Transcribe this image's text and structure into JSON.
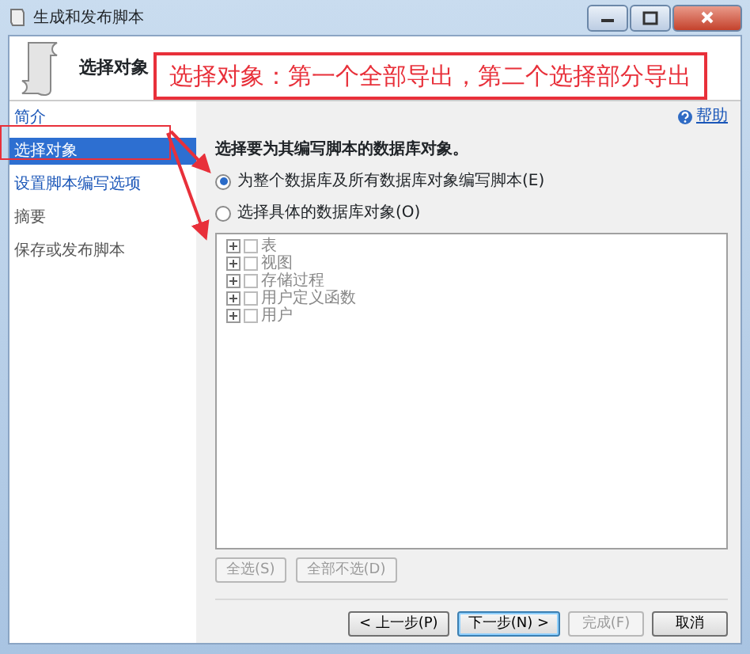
{
  "window": {
    "title": "生成和发布脚本"
  },
  "header": {
    "title": "选择对象"
  },
  "annotation": {
    "text": "选择对象：第一个全部导出，第二个选择部分导出"
  },
  "nav": [
    {
      "label": "简介",
      "selected": false,
      "enabled": true
    },
    {
      "label": "选择对象",
      "selected": true,
      "enabled": true
    },
    {
      "label": "设置脚本编写选项",
      "selected": false,
      "enabled": true
    },
    {
      "label": "摘要",
      "selected": false,
      "enabled": false
    },
    {
      "label": "保存或发布脚本",
      "selected": false,
      "enabled": false
    }
  ],
  "help": {
    "label": "帮助"
  },
  "prompt": "选择要为其编写脚本的数据库对象。",
  "options": [
    {
      "label": "为整个数据库及所有数据库对象编写脚本(E)",
      "selected": true
    },
    {
      "label": "选择具体的数据库对象(O)",
      "selected": false
    }
  ],
  "tree": {
    "disabled": true,
    "items": [
      {
        "label": "表",
        "checked": false
      },
      {
        "label": "视图",
        "checked": false
      },
      {
        "label": "存储过程",
        "checked": false
      },
      {
        "label": "用户定义函数",
        "checked": false
      },
      {
        "label": "用户",
        "checked": false
      }
    ]
  },
  "select_buttons": [
    {
      "label": "全选(S)",
      "disabled": true
    },
    {
      "label": "全部不选(D)",
      "disabled": true
    }
  ],
  "footer_buttons": [
    {
      "label": "< 上一步(P)",
      "disabled": false,
      "default": false
    },
    {
      "label": "下一步(N) >",
      "disabled": false,
      "default": true
    },
    {
      "label": "完成(F)",
      "disabled": true,
      "default": false
    },
    {
      "label": "取消",
      "disabled": false,
      "default": false
    }
  ]
}
